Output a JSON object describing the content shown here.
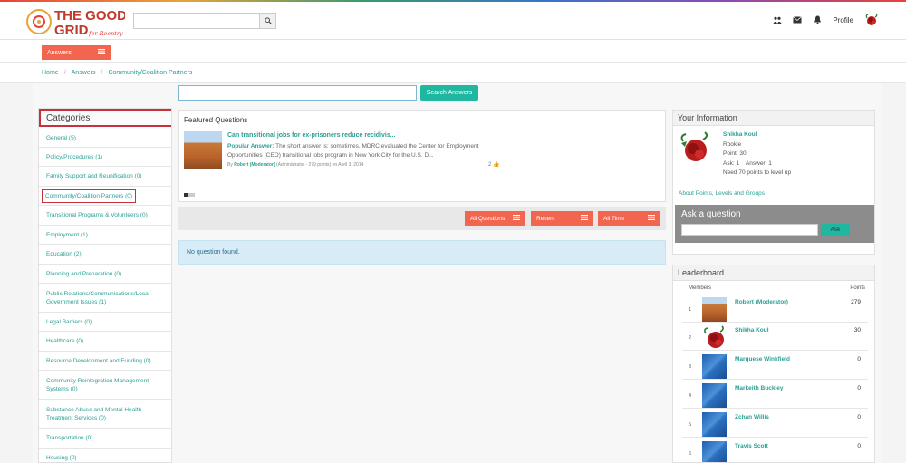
{
  "header": {
    "logo_line1": "THE GOOD",
    "logo_line2": "GRID",
    "logo_tagline": "for Reentry",
    "search_placeholder": "",
    "profile_label": "Profile"
  },
  "answers_menu": {
    "label": "Answers"
  },
  "breadcrumb": {
    "items": [
      "Home",
      "Answers",
      "Community/Coalition Partners"
    ]
  },
  "main_search": {
    "value": "",
    "button_label": "Search Answers"
  },
  "categories": {
    "title": "Categories",
    "items": [
      "General (5)",
      "Policy/Procedures (1)",
      "Family Support and Reunification (0)",
      "Community/Coalition Partners (0)",
      "Transitional Programs & Volunteers (0)",
      "Employment (1)",
      "Education (2)",
      "Planning and Preparation (0)",
      "Public Relations/Communications/Local Government Issues (1)",
      "Legal Barriers (0)",
      "Healthcare (0)",
      "Resource Development and Funding (0)",
      "Community Reintegration Management Systems (0)",
      "Substance Abuse and Mental Health Treatment Services (0)",
      "Transportation (0)",
      "Housing (0)"
    ]
  },
  "featured": {
    "title": "Featured Questions",
    "question": "Can transitional jobs for ex-prisoners reduce recidivis...",
    "answer_label": "Popular Answer:",
    "answer_text": "The short answer is: sometimes. MDRC evaluated the Center for Employment Opportunities (CEO) transitional jobs program in New York City for the U.S. D...",
    "by_prefix": "By",
    "by_name": "Robert (Moderator)",
    "by_suffix": "(Administrator - 279 points) on April 3, 2014",
    "likes": "2"
  },
  "filters": {
    "all_questions": "All Questions",
    "recent": "Recent",
    "all_time": "All Time"
  },
  "no_question": "No question found.",
  "your_info": {
    "title": "Your Information",
    "name": "Shikha Koul",
    "level": "Rookie",
    "points": "Point: 30",
    "ask_answer": "Ask: 1    Answer: 1",
    "need": "Need 70 points to level up",
    "link": "About Points, Levels and Groups",
    "ask_title": "Ask a question",
    "ask_button": "Ask"
  },
  "leaderboard": {
    "title": "Leaderboard",
    "col_members": "Members",
    "col_points": "Points",
    "rows": [
      {
        "rank": "1",
        "name": "Robert (Moderator)",
        "points": "279",
        "avatar": "canyon"
      },
      {
        "rank": "2",
        "name": "Shikha Koul",
        "points": "30",
        "avatar": "rose"
      },
      {
        "rank": "3",
        "name": "Marquese Winkfield",
        "points": "0",
        "avatar": "blue"
      },
      {
        "rank": "4",
        "name": "Markeith Buckley",
        "points": "0",
        "avatar": "blue"
      },
      {
        "rank": "5",
        "name": "Zchan Willis",
        "points": "0",
        "avatar": "blue"
      },
      {
        "rank": "6",
        "name": "Travis Scott",
        "points": "0",
        "avatar": "blue"
      }
    ]
  },
  "colors": {
    "accent_orange": "#f26650",
    "accent_teal": "#1fb79f",
    "link_teal": "#2b9f94",
    "highlight_red": "#c8313a"
  }
}
